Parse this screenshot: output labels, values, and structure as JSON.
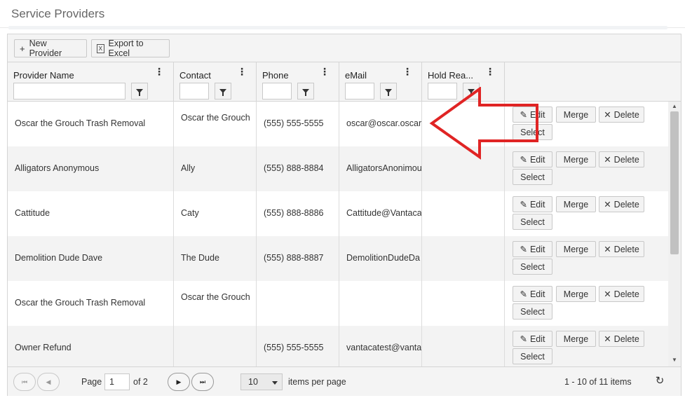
{
  "page": {
    "title": "Service Providers"
  },
  "toolbar": {
    "new_provider_label": "New Provider",
    "export_label": "Export to Excel",
    "export_icon_text": "X"
  },
  "columns": [
    {
      "label": "Provider Name"
    },
    {
      "label": "Contact"
    },
    {
      "label": "Phone"
    },
    {
      "label": "eMail"
    },
    {
      "label": "Hold Rea..."
    }
  ],
  "row_actions": {
    "edit_label": "Edit",
    "merge_label": "Merge",
    "delete_label": "Delete",
    "select_label": "Select"
  },
  "rows": [
    {
      "provider_name": "Oscar the Grouch Trash Removal",
      "contact": "Oscar the Grouch",
      "phone": "(555) 555-5555",
      "email": "oscar@oscar.oscar",
      "hold_reason": ""
    },
    {
      "provider_name": "Alligators Anonymous",
      "contact": "Ally",
      "phone": "(555) 888-8884",
      "email": "AlligatorsAnonimou",
      "hold_reason": ""
    },
    {
      "provider_name": "Cattitude",
      "contact": "Caty",
      "phone": "(555) 888-8886",
      "email": "Cattitude@Vantaca.",
      "hold_reason": ""
    },
    {
      "provider_name": "Demolition Dude Dave",
      "contact": "The Dude",
      "phone": "(555) 888-8887",
      "email": "DemolitionDudeDa",
      "hold_reason": ""
    },
    {
      "provider_name": "Oscar the Grouch Trash Removal",
      "contact": "Oscar the Grouch",
      "phone": "",
      "email": "",
      "hold_reason": ""
    },
    {
      "provider_name": "Owner Refund",
      "contact": "",
      "phone": "(555) 555-5555",
      "email": "vantacatest@vantac",
      "hold_reason": ""
    }
  ],
  "pager": {
    "page_label": "Page",
    "current_page": "1",
    "of_label": "of 2",
    "page_size": "10",
    "items_per_page_label": "items per page",
    "summary": "1 - 10 of 11 items"
  },
  "colors": {
    "annotation_arrow": "#e02424",
    "header_bg": "#f4f4f4",
    "alt_row_bg": "#f3f3f3"
  },
  "icons": {
    "new": "plus-icon",
    "export": "excel-icon",
    "edit": "pencil-icon",
    "delete": "x-icon",
    "filter": "filter-icon",
    "column_menu": "kebab-menu-icon",
    "refresh": "refresh-icon",
    "pager_first": "first-page-icon",
    "pager_prev": "prev-page-icon",
    "pager_next": "next-page-icon",
    "pager_last": "last-page-icon"
  }
}
